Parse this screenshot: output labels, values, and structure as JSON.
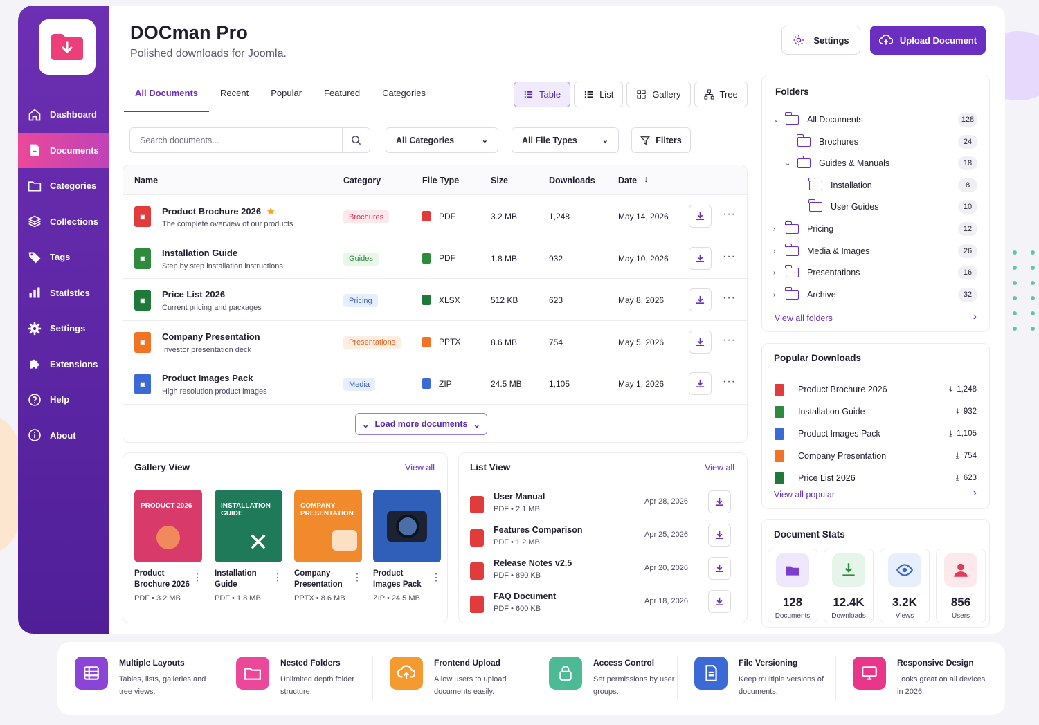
{
  "app": {
    "title": "DOCman Pro",
    "subtitle": "Polished downloads for Joomla."
  },
  "header": {
    "settings_label": "Settings",
    "upload_label": "Upload Document"
  },
  "sidebar": {
    "items": [
      {
        "label": "Dashboard",
        "icon": "home-icon"
      },
      {
        "label": "Documents",
        "icon": "document-icon",
        "active": true
      },
      {
        "label": "Categories",
        "icon": "folder-icon"
      },
      {
        "label": "Collections",
        "icon": "layers-icon"
      },
      {
        "label": "Tags",
        "icon": "tag-icon"
      },
      {
        "label": "Statistics",
        "icon": "bar-chart-icon"
      },
      {
        "label": "Settings",
        "icon": "gear-icon"
      },
      {
        "label": "Extensions",
        "icon": "puzzle-icon"
      },
      {
        "label": "Help",
        "icon": "help-icon"
      },
      {
        "label": "About",
        "icon": "info-icon"
      }
    ]
  },
  "tabs": [
    "All Documents",
    "Recent",
    "Popular",
    "Featured",
    "Categories"
  ],
  "views": [
    "Table",
    "List",
    "Gallery",
    "Tree"
  ],
  "filters": {
    "search_placeholder": "Search documents...",
    "category": "All Categories",
    "file_type": "All File Types",
    "filters_label": "Filters"
  },
  "table": {
    "headers": [
      "Name",
      "Category",
      "File Type",
      "Size",
      "Downloads",
      "Date"
    ],
    "rows": [
      {
        "name": "Product Brochure 2026",
        "desc": "The complete overview of our products",
        "category": "Brochures",
        "type": "PDF",
        "size": "3.2 MB",
        "downloads": "1,248",
        "date": "May 14, 2026",
        "featured": true,
        "color": "#e23b3b",
        "badge_bg": "#fde8ec",
        "badge_fg": "#d63357"
      },
      {
        "name": "Installation Guide",
        "desc": "Step by step installation instructions",
        "category": "Guides",
        "type": "PDF",
        "size": "1.8 MB",
        "downloads": "932",
        "date": "May 10, 2026",
        "color": "#2e8b3e",
        "badge_bg": "#e9f6ea",
        "badge_fg": "#2e8b3e"
      },
      {
        "name": "Price List 2026",
        "desc": "Current pricing and packages",
        "category": "Pricing",
        "type": "XLSX",
        "size": "512 KB",
        "downloads": "623",
        "date": "May 8, 2026",
        "color": "#1f7a3a",
        "badge_bg": "#e8effc",
        "badge_fg": "#3a64c8"
      },
      {
        "name": "Company Presentation",
        "desc": "Investor presentation deck",
        "category": "Presentations",
        "type": "PPTX",
        "size": "8.6 MB",
        "downloads": "754",
        "date": "May 5, 2026",
        "color": "#f07424",
        "badge_bg": "#fdeee2",
        "badge_fg": "#e0672a"
      },
      {
        "name": "Product Images Pack",
        "desc": "High resolution product images",
        "category": "Media",
        "type": "ZIP",
        "size": "24.5 MB",
        "downloads": "1,105",
        "date": "May 1, 2026",
        "color": "#3b6ad6",
        "badge_bg": "#e8effc",
        "badge_fg": "#3a64c8"
      }
    ],
    "load_more": "Load more documents"
  },
  "gallery": {
    "title": "Gallery View",
    "view_all": "View all",
    "items": [
      {
        "name": "Product Brochure 2026",
        "meta": "PDF • 3.2 MB",
        "thumb": "PRODUCT 2026",
        "bg": "#d83a6a"
      },
      {
        "name": "Installation Guide",
        "meta": "PDF • 1.8 MB",
        "thumb": "INSTALLATION GUIDE",
        "bg": "#1f7a5a"
      },
      {
        "name": "Company Presentation",
        "meta": "PPTX • 8.6 MB",
        "thumb": "COMPANY PRESENTATION",
        "bg": "#f08a2c"
      },
      {
        "name": "Product Images Pack",
        "meta": "ZIP • 24.5 MB",
        "thumb": "",
        "bg": "#2f5fb8"
      }
    ]
  },
  "list_view": {
    "title": "List View",
    "view_all": "View all",
    "items": [
      {
        "name": "User Manual",
        "meta": "PDF • 2.1 MB",
        "date": "Apr 28, 2026"
      },
      {
        "name": "Features Comparison",
        "meta": "PDF • 1.2 MB",
        "date": "Apr 25, 2026"
      },
      {
        "name": "Release Notes v2.5",
        "meta": "PDF • 890 KB",
        "date": "Apr 20, 2026"
      },
      {
        "name": "FAQ Document",
        "meta": "PDF • 600 KB",
        "date": "Apr 18, 2026"
      }
    ]
  },
  "folders": {
    "title": "Folders",
    "view_all": "View all folders",
    "items": [
      {
        "name": "All Documents",
        "count": "128",
        "level": 0,
        "arrow": "⌄"
      },
      {
        "name": "Brochures",
        "count": "24",
        "level": 1,
        "arrow": ""
      },
      {
        "name": "Guides & Manuals",
        "count": "18",
        "level": 1,
        "arrow": "⌄"
      },
      {
        "name": "Installation",
        "count": "8",
        "level": 2,
        "arrow": ""
      },
      {
        "name": "User Guides",
        "count": "10",
        "level": 2,
        "arrow": ""
      },
      {
        "name": "Pricing",
        "count": "12",
        "level": 0,
        "arrow": "›"
      },
      {
        "name": "Media & Images",
        "count": "26",
        "level": 0,
        "arrow": "›"
      },
      {
        "name": "Presentations",
        "count": "16",
        "level": 0,
        "arrow": "›"
      },
      {
        "name": "Archive",
        "count": "32",
        "level": 0,
        "arrow": "›"
      }
    ]
  },
  "popular": {
    "title": "Popular Downloads",
    "view_all": "View all popular",
    "items": [
      {
        "name": "Product Brochure 2026",
        "count": "1,248",
        "color": "#e23b3b"
      },
      {
        "name": "Installation Guide",
        "count": "932",
        "color": "#2e8b3e"
      },
      {
        "name": "Product Images Pack",
        "count": "1,105",
        "color": "#3b6ad6"
      },
      {
        "name": "Company Presentation",
        "count": "754",
        "color": "#f07424"
      },
      {
        "name": "Price List 2026",
        "count": "623",
        "color": "#1f7a3a"
      }
    ]
  },
  "stats": {
    "title": "Document Stats",
    "items": [
      {
        "value": "128",
        "label": "Documents",
        "bg": "#efe7fc",
        "fg": "#7b3fd0"
      },
      {
        "value": "12.4K",
        "label": "Downloads",
        "bg": "#e6f5e9",
        "fg": "#2e8b3e"
      },
      {
        "value": "3.2K",
        "label": "Views",
        "bg": "#e8effc",
        "fg": "#3a64c8"
      },
      {
        "value": "856",
        "label": "Users",
        "bg": "#fde8ec",
        "fg": "#e23b5b"
      }
    ]
  },
  "features": [
    {
      "title": "Multiple Layouts",
      "desc": "Tables, lists, galleries and tree views.",
      "color": "#8b45d6"
    },
    {
      "title": "Nested Folders",
      "desc": "Unlimited depth folder structure.",
      "color": "#ec4899"
    },
    {
      "title": "Frontend Upload",
      "desc": "Allow users to upload documents easily.",
      "color": "#f59a2e"
    },
    {
      "title": "Access Control",
      "desc": "Set permissions by user groups.",
      "color": "#4cba94"
    },
    {
      "title": "File Versioning",
      "desc": "Keep multiple versions of documents.",
      "color": "#3b6ad6"
    },
    {
      "title": "Responsive Design",
      "desc": "Looks great on all devices in 2026.",
      "color": "#e8368a"
    }
  ]
}
